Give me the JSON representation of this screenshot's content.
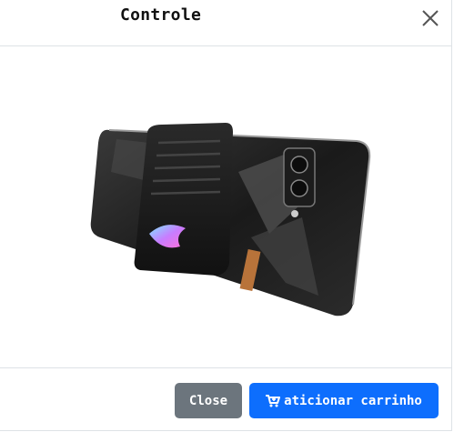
{
  "modal": {
    "title": "Controle",
    "close_icon": "close-icon",
    "image_alt_icon": "product-photo"
  },
  "footer": {
    "close_label": "Close",
    "cart_label": "aticionar carrinho",
    "cart_icon": "cart-plus-icon"
  },
  "colors": {
    "primary": "#0d6efd",
    "secondary": "#6c757d",
    "border": "#dee2e6"
  }
}
